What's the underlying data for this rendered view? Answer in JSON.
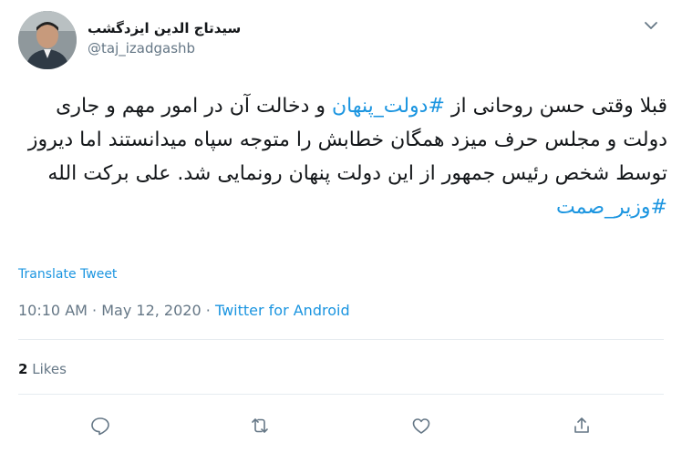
{
  "author": {
    "display_name": "سیدتاج الدین ایزدگشب",
    "handle": "@taj_izadgashb"
  },
  "tweet": {
    "text_before": "قبلا وقتی حسن روحانی از ",
    "hashtag_1": "#دولت_پنهان",
    "text_after": " و دخالت آن در امور مهم و جاری دولت و مجلس حرف میزد همگان خطابش را متوجه سپاه میدانستند اما دیروز توسط شخص رئیس جمهور از این دولت پنهان رونمایی شد. علی برکت الله",
    "hashtag_2": "#وزیر_صمت"
  },
  "translate_label": "Translate Tweet",
  "meta": {
    "time": "10:10 AM",
    "date": "May 12, 2020",
    "separator": "·",
    "source": "Twitter for Android"
  },
  "stats": {
    "likes_count": "2",
    "likes_label": "Likes"
  },
  "actions": [
    "reply-icon",
    "retweet-icon",
    "like-icon",
    "share-icon"
  ],
  "colors": {
    "link": "#1b95e0",
    "secondary_text": "#657786",
    "divider": "#e6ecf0"
  }
}
